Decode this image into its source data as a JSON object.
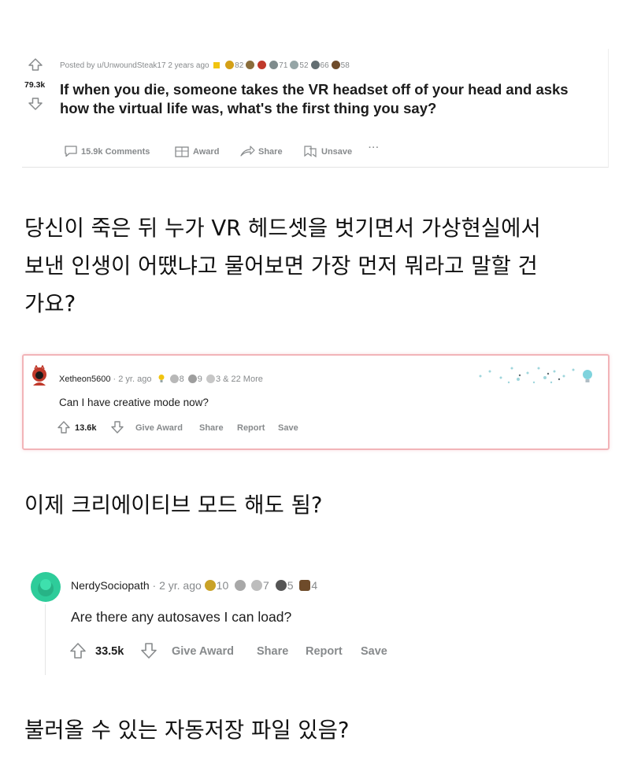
{
  "post": {
    "score": "79.3k",
    "posted_by": "Posted by u/UnwoundSteak17 2 years ago",
    "awards": [
      {
        "icon": "wholesome-award-icon",
        "count": "82",
        "color": "#d4a017"
      },
      {
        "icon": "helpful-award-icon",
        "count": "",
        "color": "#8a6d3b"
      },
      {
        "icon": "hugz-award-icon",
        "count": "",
        "color": "#c0392b"
      },
      {
        "icon": "laughing-award-icon",
        "count": "71",
        "color": "#7f8c8d"
      },
      {
        "icon": "mind-blown-award-icon",
        "count": "52",
        "color": "#95a5a6"
      },
      {
        "icon": "coin-award-icon",
        "count": "66",
        "color": "#636e72"
      },
      {
        "icon": "bear-award-icon",
        "count": "58",
        "color": "#6e4b2a"
      }
    ],
    "title_line1": "If when you die, someone takes the VR headset off of your head and asks",
    "title_line2": "how the virtual life was, what's the first thing you say?",
    "actions": {
      "comments": "15.9k Comments",
      "award": "Award",
      "share": "Share",
      "unsave": "Unsave",
      "more": "···"
    }
  },
  "translation1": {
    "line1": "당신이 죽은 뒤 누가 VR 헤드셋을 벗기면서 가상현실에서",
    "line2": "보낸 인생이 어땠냐고 물어보면 가장 먼저 뭐라고 말할 건",
    "line3": "가요?"
  },
  "comment1": {
    "username": "Xetheon5600",
    "time": "· 2 yr. ago",
    "award_counts": [
      "8",
      "9",
      "3 & 22 More"
    ],
    "body": "Can I have creative mode now?",
    "score": "13.6k",
    "give_award": "Give Award",
    "share": "Share",
    "report": "Report",
    "save": "Save"
  },
  "translation2": {
    "line1": "이제 크리에이티브 모드 해도 됨?"
  },
  "comment2": {
    "username": "NerdySociopath",
    "time": "· 2 yr. ago",
    "award_counts": [
      "10",
      "7",
      "5",
      "4"
    ],
    "body": "Are there any autosaves I can load?",
    "score": "33.5k",
    "give_award": "Give Award",
    "share": "Share",
    "report": "Report",
    "save": "Save"
  },
  "translation3": {
    "line1": "불러올 수 있는 자동저장 파일 있음?"
  }
}
